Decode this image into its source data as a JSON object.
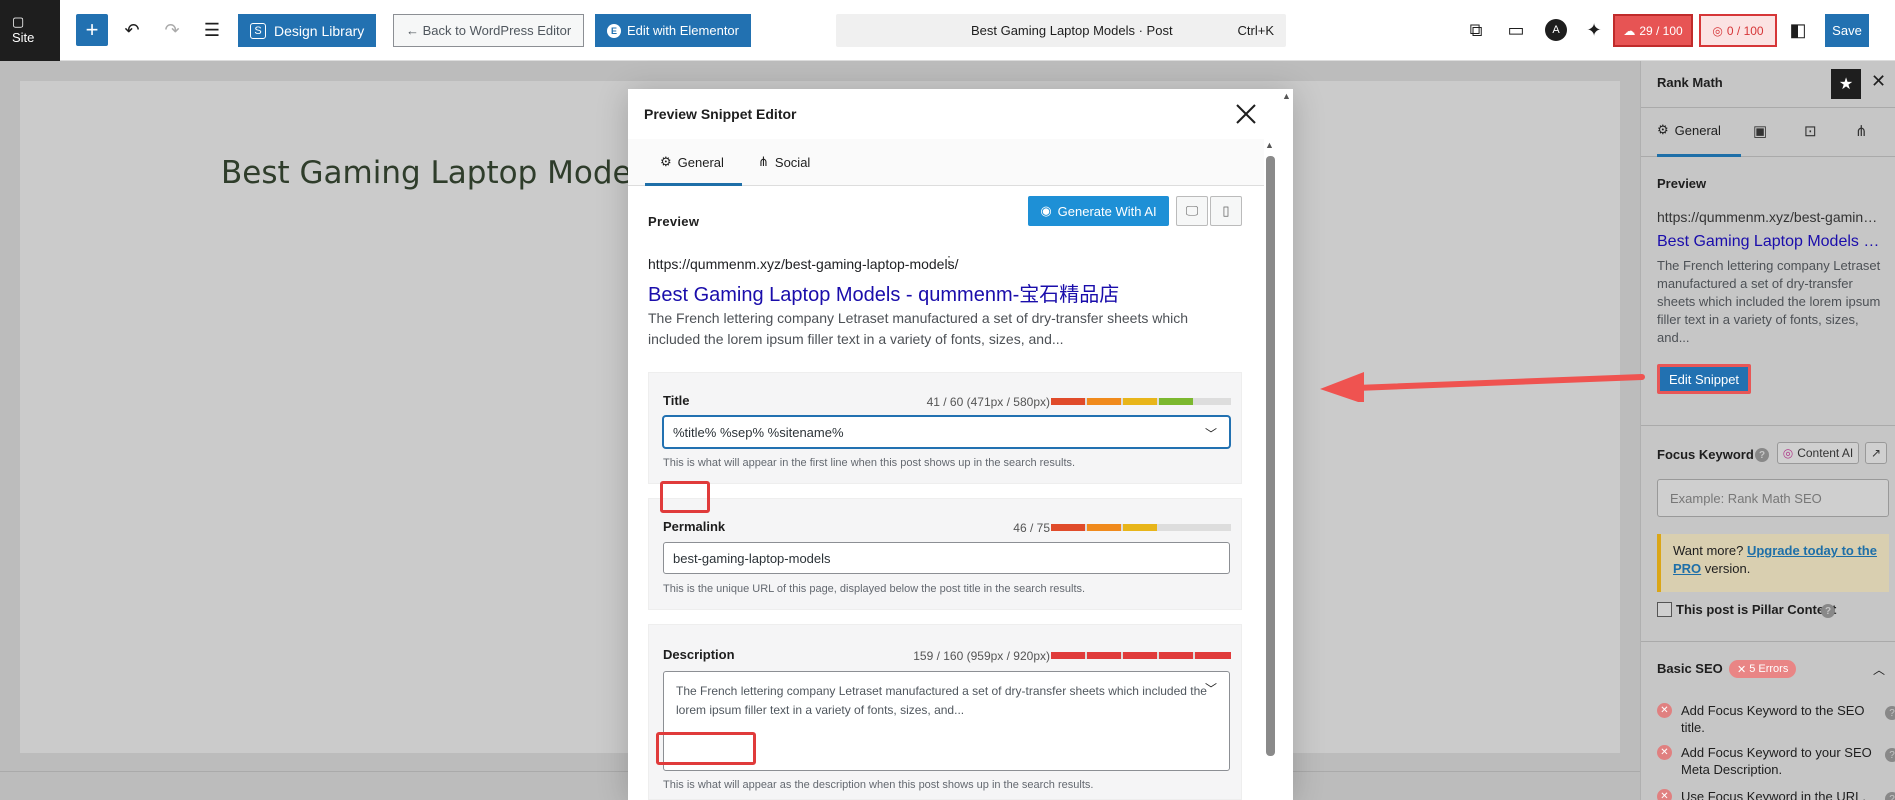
{
  "topbar": {
    "site_label": "Site",
    "design_library": "Design Library",
    "back_to_wp": "← Back to WordPress Editor",
    "edit_elementor": "Edit with Elementor",
    "doc_title": "Best Gaming Laptop Models · Post",
    "shortcut": "Ctrl+K",
    "seo_score": "29 / 100",
    "content_score": "0 / 100",
    "save": "Save"
  },
  "canvas": {
    "post_title": "Best Gaming Laptop Models"
  },
  "sidebar": {
    "title": "Rank Math",
    "tab_general": "General",
    "preview_label": "Preview",
    "preview_url": "https://qummenm.xyz/best-gaming...",
    "preview_title": "Best Gaming Laptop Models - ...",
    "preview_desc": "The French lettering company Letraset manufactured a set of dry-transfer sheets which included the lorem ipsum filler text in a variety of fonts, sizes, and...",
    "edit_snippet": "Edit Snippet",
    "focus_keyword_label": "Focus Keyword",
    "content_ai": "Content AI",
    "focus_placeholder": "Example: Rank Math SEO",
    "upgrade_prefix": "Want more?",
    "upgrade_link": "Upgrade today to the PRO",
    "upgrade_suffix": "version.",
    "pillar_label": "This post is Pillar Content",
    "basic_seo": "Basic SEO",
    "errors_badge": "5 Errors",
    "checks": [
      "Add Focus Keyword to the SEO title.",
      "Add Focus Keyword to your SEO Meta Description.",
      "Use Focus Keyword in the URL."
    ]
  },
  "modal": {
    "title": "Preview Snippet Editor",
    "tabs": {
      "general": "General",
      "social": "Social"
    },
    "preview_label": "Preview",
    "generate_ai": "Generate With AI",
    "preview_url": "https://qummenm.xyz/best-gaming-laptop-models/",
    "preview_title": "Best Gaming Laptop Models - qummenm-宝石精品店",
    "preview_desc": "The French lettering company Letraset manufactured a set of dry-transfer sheets which included the lorem ipsum filler text in a variety of fonts, sizes, and...",
    "title_field": {
      "label": "Title",
      "count": "41 / 60 (471px / 580px)",
      "value": "%title% %sep% %sitename%",
      "help": "This is what will appear in the first line when this post shows up in the search results."
    },
    "permalink_field": {
      "label": "Permalink",
      "count": "46 / 75",
      "value": "best-gaming-laptop-models",
      "help": "This is the unique URL of this page, displayed below the post title in the search results."
    },
    "description_field": {
      "label": "Description",
      "count": "159 / 160 (959px / 920px)",
      "value": "The French lettering company Letraset manufactured a set of dry-transfer sheets which included the lorem ipsum filler text in a variety of fonts, sizes, and...",
      "help": "This is what will appear as the description when this post shows up in the search results."
    }
  },
  "colors": {
    "accent": "#2271b1",
    "highlight": "#e03b3b",
    "meter_red": "#e04b2a",
    "meter_orange": "#f08a1c",
    "meter_yellow": "#e8b51a",
    "meter_green": "#7cb82f"
  }
}
